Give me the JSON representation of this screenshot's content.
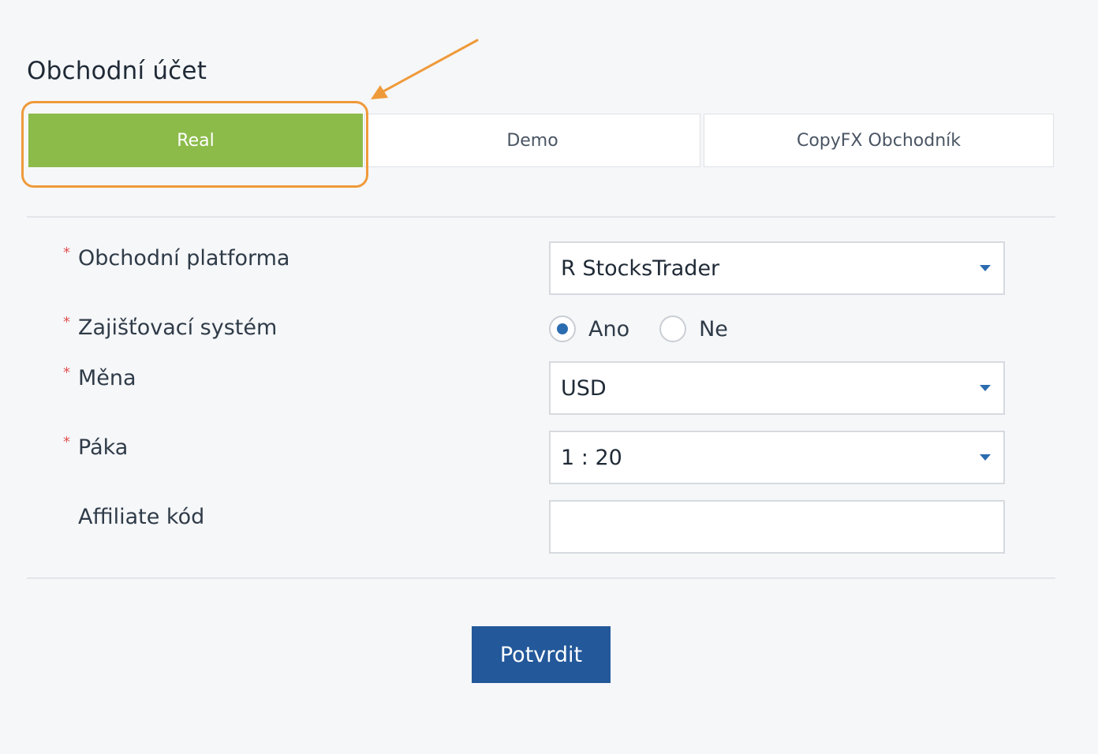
{
  "page": {
    "title": "Obchodní účet"
  },
  "tabs": [
    {
      "label": "Real",
      "active": true
    },
    {
      "label": "Demo",
      "active": false
    },
    {
      "label": "CopyFX Obchodník",
      "active": false
    }
  ],
  "form": {
    "platform": {
      "label": "Obchodní platforma",
      "required": true,
      "value": "R StocksTrader"
    },
    "hedging": {
      "label": "Zajišťovací systém",
      "required": true,
      "options": [
        {
          "label": "Ano",
          "checked": true
        },
        {
          "label": "Ne",
          "checked": false
        }
      ]
    },
    "currency": {
      "label": "Měna",
      "required": true,
      "value": "USD"
    },
    "leverage": {
      "label": "Páka",
      "required": true,
      "value": "1 : 20"
    },
    "affiliate": {
      "label": "Affiliate kód",
      "required": false,
      "value": "",
      "placeholder": ""
    },
    "required_marker": "*"
  },
  "actions": {
    "submit_label": "Potvrdit"
  },
  "colors": {
    "active_tab": "#8cbb4a",
    "highlight": "#ef9a3a",
    "primary_button": "#23589a",
    "required": "#e05252"
  }
}
